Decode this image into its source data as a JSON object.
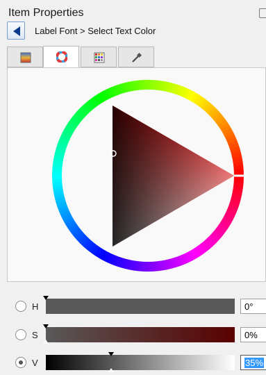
{
  "panel": {
    "title": "Item Properties",
    "breadcrumb": "Label Font > Select Text Color"
  },
  "tabs": [
    {
      "name": "color-swatches",
      "icon": "gradient-icon",
      "active": false
    },
    {
      "name": "color-wheel",
      "icon": "color-wheel-icon",
      "active": true
    },
    {
      "name": "palette",
      "icon": "palette-grid-icon",
      "active": false
    },
    {
      "name": "eyedropper",
      "icon": "eyedropper-icon",
      "active": false
    }
  ],
  "channels": [
    {
      "label": "H",
      "value": "0°",
      "checked": false,
      "thumb": 0.0
    },
    {
      "label": "S",
      "value": "0%",
      "checked": false,
      "thumb": 0.0
    },
    {
      "label": "V",
      "value": "35%",
      "checked": true,
      "thumb": 0.35
    }
  ],
  "colors": {
    "hue_red": "#ff0000",
    "value_selection": "#3399ff"
  }
}
